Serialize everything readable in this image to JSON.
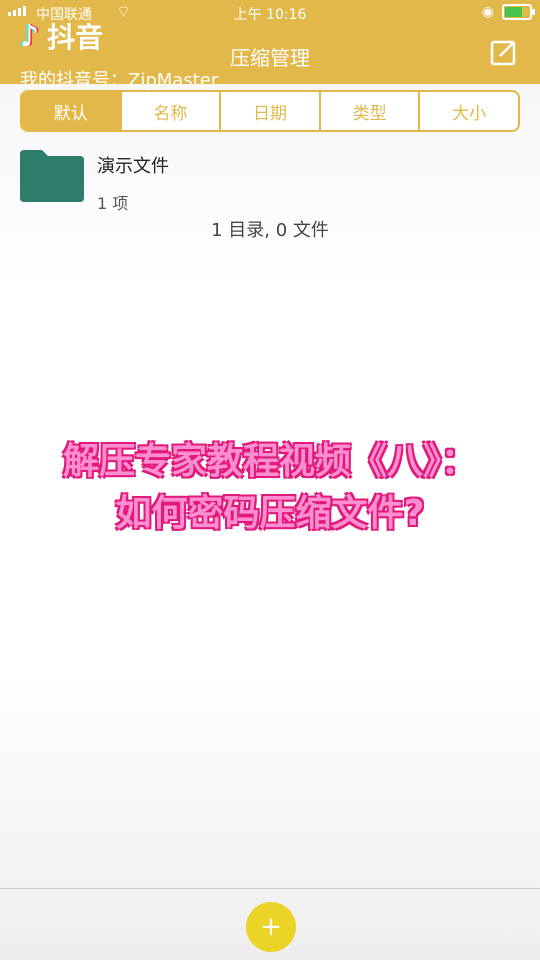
{
  "status_bar": {
    "carrier": "中国联通",
    "time": "上午 10:16"
  },
  "brand": {
    "name": "抖音",
    "icon": "tiktok-note-icon"
  },
  "header": {
    "title": "压缩管理",
    "edit_icon": "edit-icon",
    "account_line": "我的抖音号：ZipMaster"
  },
  "sort_tabs": [
    "默认",
    "名称",
    "日期",
    "类型",
    "大小"
  ],
  "files": [
    {
      "name": "演示文件",
      "count": "1 项",
      "icon": "folder-icon"
    }
  ],
  "summary": "1 目录, 0 文件",
  "overlay": {
    "line1": "解压专家教程视频《八》：",
    "line2": "如何密码压缩文件?"
  },
  "fab": {
    "label": "+"
  },
  "colors": {
    "accent": "#e3b84a",
    "folder": "#2e7d6a",
    "overlay_text": "#ff8ed0",
    "fab": "#ebd427"
  }
}
